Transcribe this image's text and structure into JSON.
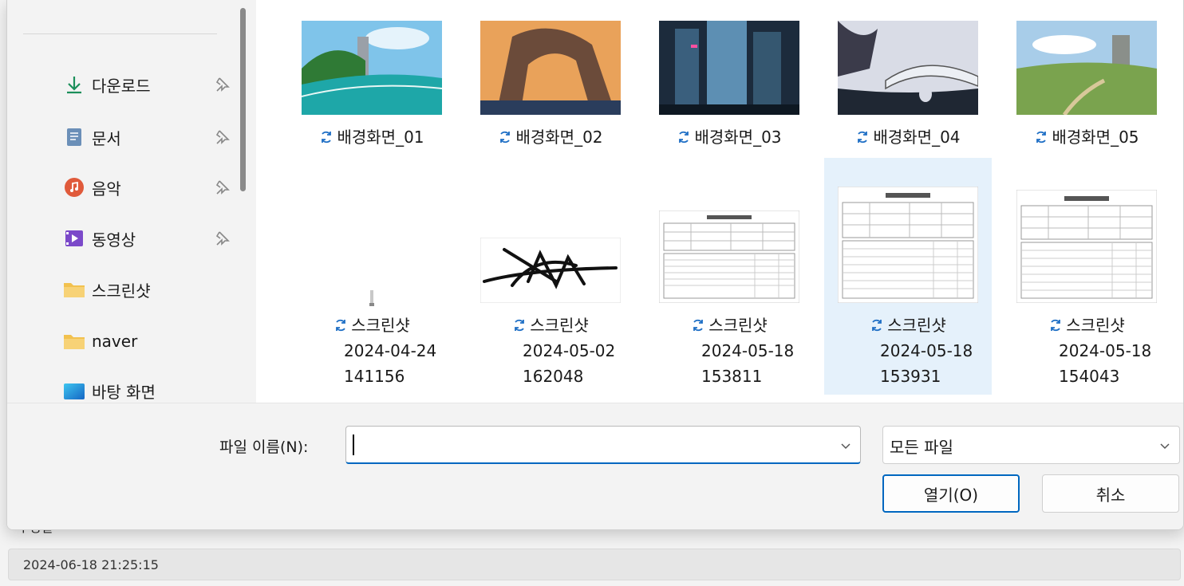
{
  "nav": {
    "items": [
      {
        "label": "다운로드",
        "icon": "download-icon",
        "pinned": true
      },
      {
        "label": "문서",
        "icon": "document-icon",
        "pinned": true
      },
      {
        "label": "음악",
        "icon": "music-icon",
        "pinned": true
      },
      {
        "label": "동영상",
        "icon": "video-icon",
        "pinned": true
      },
      {
        "label": "스크린샷",
        "icon": "folder-icon",
        "pinned": false
      },
      {
        "label": "naver",
        "icon": "folder-icon",
        "pinned": false
      },
      {
        "label": "바탕 화면",
        "icon": "desktop-icon",
        "pinned": false
      }
    ]
  },
  "files": [
    {
      "name": "배경화면_01",
      "kind": "landscape",
      "sync_icon": "sync-icon"
    },
    {
      "name": "배경화면_02",
      "kind": "landscape",
      "sync_icon": "sync-icon"
    },
    {
      "name": "배경화면_03",
      "kind": "landscape",
      "sync_icon": "sync-icon"
    },
    {
      "name": "배경화면_04",
      "kind": "landscape",
      "sync_icon": "sync-icon"
    },
    {
      "name": "배경화면_05",
      "kind": "landscape",
      "sync_icon": "sync-icon"
    },
    {
      "name": "스크린샷",
      "line2": "2024-04-24",
      "line3": "141156",
      "kind": "blank"
    },
    {
      "name": "스크린샷",
      "line2": "2024-05-02",
      "line3": "162048",
      "kind": "signature"
    },
    {
      "name": "스크린샷",
      "line2": "2024-05-18",
      "line3": "153811",
      "kind": "form"
    },
    {
      "name": "스크린샷",
      "line2": "2024-05-18",
      "line3": "153931",
      "kind": "form",
      "selected": true
    },
    {
      "name": "스크린샷",
      "line2": "2024-05-18",
      "line3": "154043",
      "kind": "form"
    }
  ],
  "filename": {
    "label": "파일 이름(N):",
    "value": ""
  },
  "filetype": {
    "selected": "모든 파일"
  },
  "buttons": {
    "open": "열기(O)",
    "cancel": "취소"
  },
  "background_form": {
    "label": "수정일",
    "date_value": "2024-06-18 21:25:15"
  },
  "colors": {
    "accent": "#0067c0",
    "selected_bg": "#e5f1fb",
    "nav_bg": "#f3f3f3"
  }
}
